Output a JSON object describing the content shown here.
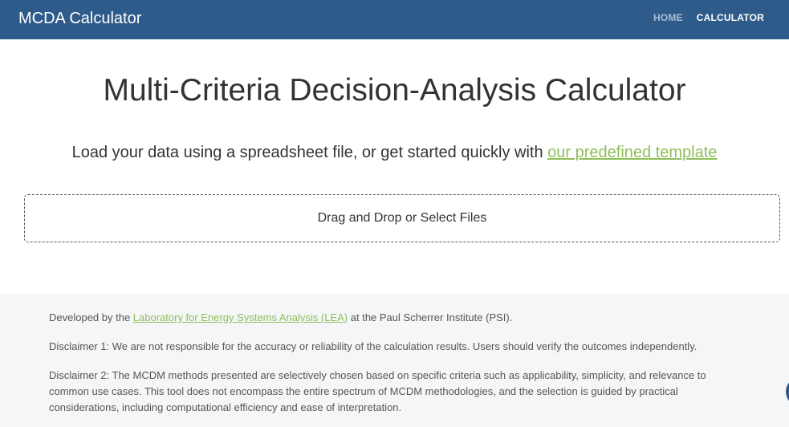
{
  "header": {
    "brand": "MCDA Calculator",
    "nav": [
      {
        "label": "HOME",
        "active": false
      },
      {
        "label": "CALCULATOR",
        "active": true
      }
    ]
  },
  "main": {
    "title": "Multi-Criteria Decision-Analysis Calculator",
    "subtitle_prefix": "Load your data using a spreadsheet file, or get started quickly with ",
    "template_link": "our predefined template",
    "dropzone_label": "Drag and Drop or Select Files"
  },
  "footer": {
    "developed_prefix": "Developed by the ",
    "lea_link": "Laboratory for Energy Systems Analysis (LEA)",
    "developed_suffix": " at the Paul Scherrer Institute (PSI).",
    "disclaimer1": "Disclaimer 1: We are not responsible for the accuracy or reliability of the calculation results. Users should verify the outcomes independently.",
    "disclaimer2": "Disclaimer 2: The MCDM methods presented are selectively chosen based on specific criteria such as applicability, simplicity, and relevance to common use cases. This tool does not encompass the entire spectrum of MCDM methodologies, and the selection is guided by practical considerations, including computational efficiency and ease of interpretation."
  },
  "colors": {
    "navbar": "#2f5b8a",
    "link_green": "#8fbf5a",
    "footer_bg": "#f4f6f8"
  }
}
